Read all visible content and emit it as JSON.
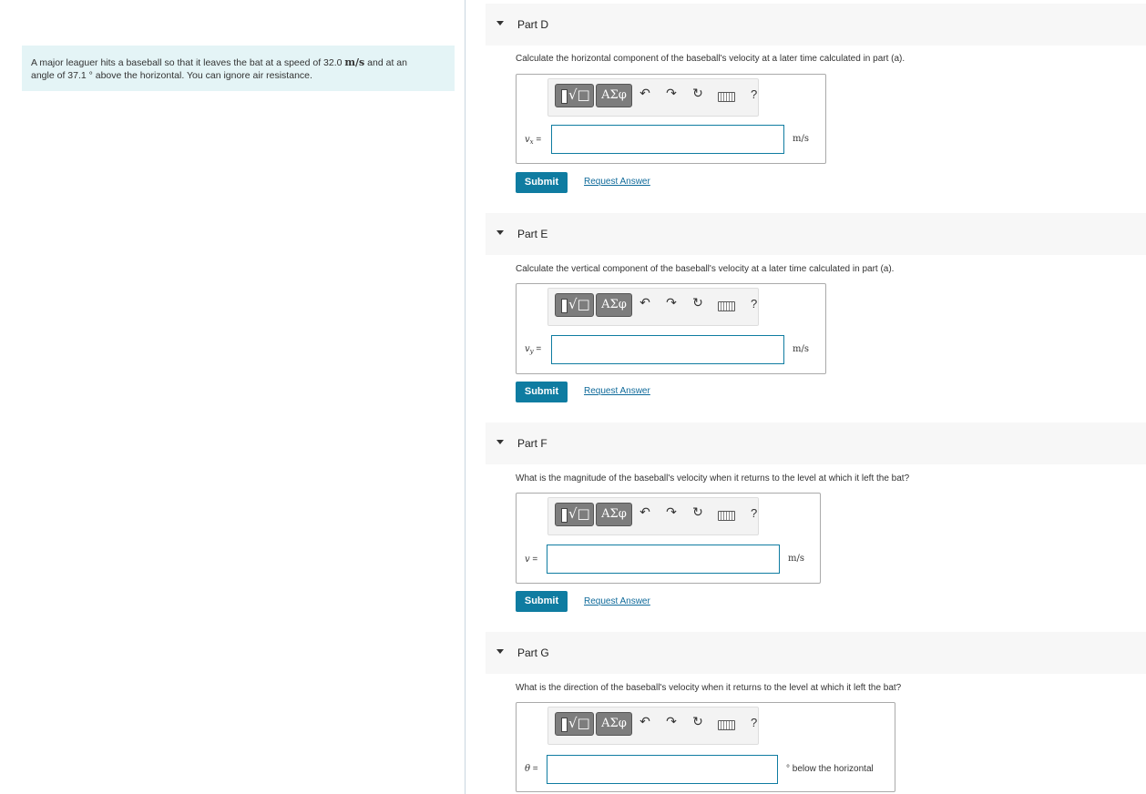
{
  "problem": {
    "text_before_speed": "A major leaguer hits a baseball so that it leaves the bat at a speed of 32.0 ",
    "speed_unit": "m/s",
    "text_after_speed": " and at an",
    "line2": "angle of 37.1 ° above the horizontal. You can ignore air resistance."
  },
  "toolbar": {
    "greek_label": "ΑΣφ",
    "undo_glyph": "↶",
    "redo_glyph": "↷",
    "reset_glyph": "↻",
    "help_label": "?",
    "icons": [
      "templates-icon",
      "greek-symbols-icon",
      "undo-icon",
      "redo-icon",
      "reset-icon",
      "keyboard-icon",
      "help-icon"
    ]
  },
  "buttons": {
    "submit_label": "Submit",
    "request_label": "Request Answer"
  },
  "parts": [
    {
      "title": "Part D",
      "question": "Calculate the horizontal component of the baseball's velocity at a later time calculated in part (a).",
      "var": "v",
      "var_sub": "x",
      "equals": " =",
      "unit": "m/s"
    },
    {
      "title": "Part E",
      "question": "Calculate the vertical component of the baseball's velocity at a later time calculated in part (a).",
      "var": "v",
      "var_sub": "y",
      "equals": " =",
      "unit": "m/s"
    },
    {
      "title": "Part F",
      "question": "What is the magnitude of the baseball's velocity when it returns to the level at which it left the bat?",
      "var": "v",
      "var_sub": "",
      "equals": " =",
      "unit": "m/s"
    },
    {
      "title": "Part G",
      "question": "What is the direction of the baseball's velocity when it returns to the level at which it left the bat?",
      "var": "θ",
      "var_sub": "",
      "equals": " =",
      "unit": "° below the horizontal"
    }
  ],
  "colors": {
    "accent": "#0f7ca1",
    "problem_bg": "#e4f4f6",
    "header_bg": "#f7f7f7"
  }
}
